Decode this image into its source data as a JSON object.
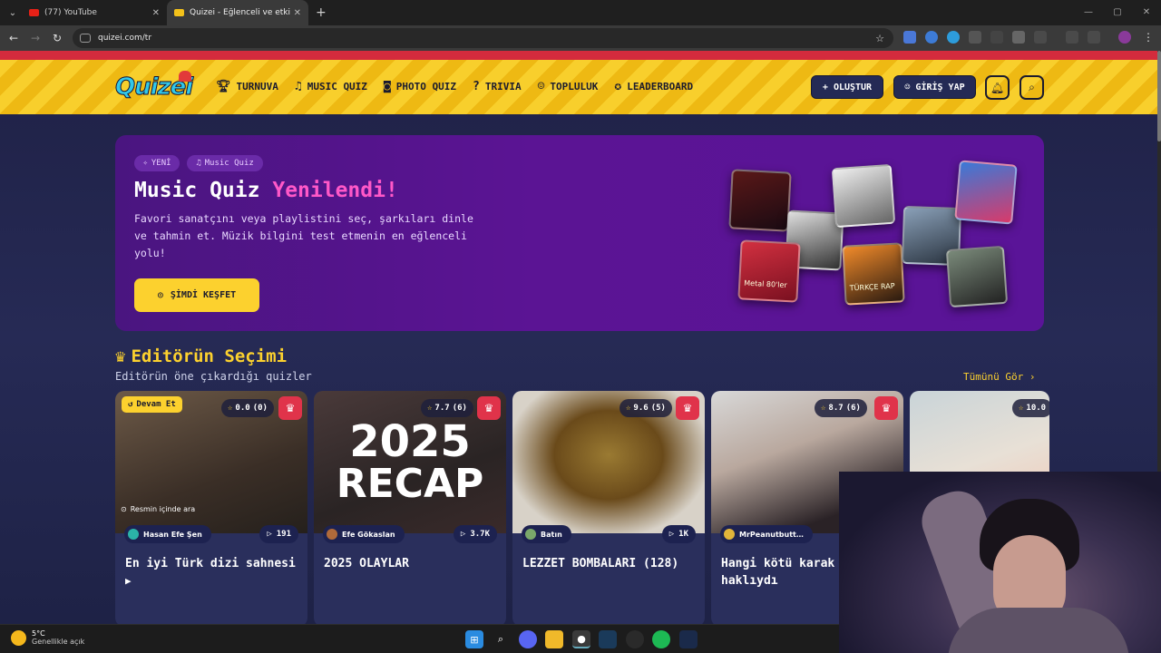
{
  "browser": {
    "tabs": [
      {
        "title": "(77) YouTube",
        "active": false
      },
      {
        "title": "Quizei - Eğlenceli ve etkileşimli",
        "active": true
      }
    ],
    "url": "quizei.com/tr"
  },
  "header": {
    "logo": "Quizei",
    "nav": [
      {
        "label": "TURNUVA",
        "icon": "trophy-icon"
      },
      {
        "label": "MUSIC QUIZ",
        "icon": "music-note-icon"
      },
      {
        "label": "PHOTO QUIZ",
        "icon": "camera-icon"
      },
      {
        "label": "TRIVIA",
        "icon": "question-bubble-icon"
      },
      {
        "label": "TOPLULUK",
        "icon": "users-icon"
      },
      {
        "label": "LEADERBOARD",
        "icon": "medal-icon"
      }
    ],
    "create_label": "OLUŞTUR",
    "login_label": "GİRİŞ YAP"
  },
  "hero": {
    "tag_new": "YENİ",
    "tag_music": "Music Quiz",
    "title_main": "Music Quiz",
    "title_accent": "Yenilendi!",
    "description": "Favori sanatçını veya playlistini seç, şarkıları dinle ve tahmin et. Müzik bilgini test etmenin en eğlenceli yolu!",
    "cta": "ŞİMDİ KEŞFET",
    "cover_text": "Metal 80'ler",
    "cover_text2": "TÜRKÇE RAP"
  },
  "section": {
    "title": "Editörün Seçimi",
    "subtitle": "Editörün öne çıkardığı quizler",
    "see_all": "Tümünü Gör ›"
  },
  "cards": [
    {
      "badge": "Devam Et",
      "rating": "0.0",
      "count": "(0)",
      "author": "Hasan Efe Şen",
      "plays": "191",
      "title": "En iyi Türk dizi sahnesi",
      "overlay": "Resmin içinde ara"
    },
    {
      "rating": "7.7",
      "count": "(6)",
      "author": "Efe Gökaslan",
      "plays": "3.7K",
      "title": "2025 OLAYLAR",
      "overlay_top": "2025",
      "overlay_bottom": "RECAP"
    },
    {
      "rating": "9.6",
      "count": "(5)",
      "author": "Batın",
      "plays": "1K",
      "title": "LEZZET BOMBALARI (128)"
    },
    {
      "rating": "8.7",
      "count": "(6)",
      "author": "MrPeanutbutt…",
      "plays": "",
      "title": "Hangi kötü karak aslında haklıydı"
    },
    {
      "rating": "10.0",
      "count": "",
      "author": "",
      "plays": "",
      "title": ""
    }
  ],
  "taskbar": {
    "temp": "5°C",
    "condition": "Genellikle açık"
  },
  "colors": {
    "accent_yellow": "#fcd12e",
    "accent_pink": "#ff58c8",
    "hero_purple": "#5b1494",
    "crown_red": "#e0334a"
  }
}
